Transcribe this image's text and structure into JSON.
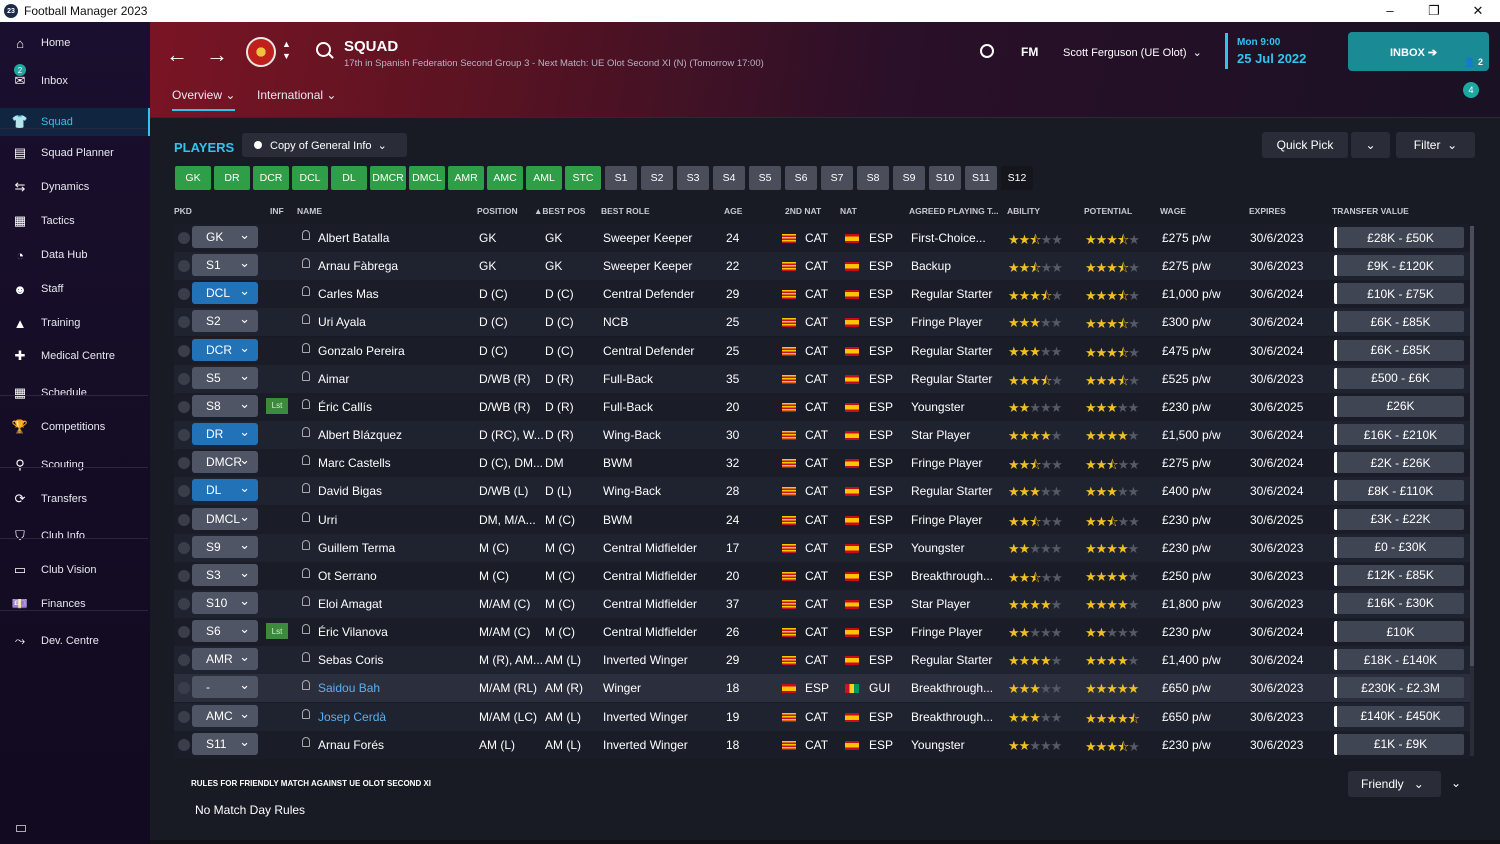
{
  "window": {
    "title": "Football Manager 2023",
    "app_icon": "23",
    "controls": [
      "–",
      "❐",
      "✕"
    ]
  },
  "sidebar": {
    "items": [
      {
        "label": "Home",
        "icon": "home-icon",
        "glyph": "⌂"
      },
      {
        "label": "Inbox",
        "icon": "inbox-icon",
        "glyph": "✉",
        "badge": "2"
      },
      {
        "label": "Squad",
        "icon": "shirt-icon",
        "glyph": "👕"
      },
      {
        "label": "Squad Planner",
        "icon": "clipboard-icon",
        "glyph": "▤"
      },
      {
        "label": "Dynamics",
        "icon": "dynamics-icon",
        "glyph": "⇆"
      },
      {
        "label": "Tactics",
        "icon": "tactics-icon",
        "glyph": "▦"
      },
      {
        "label": "Data Hub",
        "icon": "data-hub-icon",
        "glyph": "◔"
      },
      {
        "label": "Staff",
        "icon": "staff-icon",
        "glyph": "☻"
      },
      {
        "label": "Training",
        "icon": "training-icon",
        "glyph": "▲"
      },
      {
        "label": "Medical Centre",
        "icon": "medical-icon",
        "glyph": "✚"
      },
      {
        "label": "Schedule",
        "icon": "calendar-icon",
        "glyph": "▦"
      },
      {
        "label": "Competitions",
        "icon": "trophy-icon",
        "glyph": "🏆"
      },
      {
        "label": "Scouting",
        "icon": "scouting-icon",
        "glyph": "⚲"
      },
      {
        "label": "Transfers",
        "icon": "transfers-icon",
        "glyph": "⟳"
      },
      {
        "label": "Club Info",
        "icon": "shield-icon",
        "glyph": "⛉"
      },
      {
        "label": "Club Vision",
        "icon": "vision-icon",
        "glyph": "▭"
      },
      {
        "label": "Finances",
        "icon": "finances-icon",
        "glyph": "💷"
      },
      {
        "label": "Dev. Centre",
        "icon": "dev-centre-icon",
        "glyph": "⤳"
      }
    ]
  },
  "header": {
    "title": "SQUAD",
    "subtitle": "17th in Spanish Federation Second Group 3 - Next Match: UE Olot Second XI (N) (Tomorrow 17:00)",
    "tabs": [
      {
        "label": "Overview"
      },
      {
        "label": "International"
      }
    ],
    "fm_logo": "FM",
    "manager": "Scott Ferguson (UE Olot)",
    "time": "Mon 9:00",
    "date": "25 Jul 2022",
    "inbox_label": "INBOX",
    "inbox_count": "2",
    "notifications": "4"
  },
  "toolbar": {
    "players_label": "PLAYERS",
    "view_label": "Copy of General Info",
    "quick_pick": "Quick Pick",
    "filter": "Filter"
  },
  "position_filters": [
    "GK",
    "DR",
    "DCR",
    "DCL",
    "DL",
    "DMCR",
    "DMCL",
    "AMR",
    "AMC",
    "AML",
    "STC",
    "S1",
    "S2",
    "S3",
    "S4",
    "S5",
    "S6",
    "S7",
    "S8",
    "S9",
    "S10",
    "S11",
    "S12"
  ],
  "columns": {
    "pkd": "PKD",
    "inf": "INF",
    "name": "NAME",
    "position": "POSITION",
    "best_pos": "BEST POS",
    "best_role": "BEST ROLE",
    "age": "AGE",
    "nat2": "2ND NAT",
    "nat": "NAT",
    "agreed": "AGREED PLAYING T...",
    "ability": "ABILITY",
    "potential": "POTENTIAL",
    "wage": "WAGE",
    "expires": "EXPIRES",
    "value": "TRANSFER VALUE"
  },
  "players": [
    {
      "slot": "GK",
      "name": "Albert Batalla",
      "position": "GK",
      "best_pos": "GK",
      "role": "Sweeper Keeper",
      "age": "24",
      "nat2": "CAT",
      "nat": "ESP",
      "agreed": "First-Choice...",
      "ability": 2.5,
      "potential": 3.5,
      "wage": "£275 p/w",
      "expires": "30/6/2023",
      "value": "£28K - £50K"
    },
    {
      "slot": "S1",
      "name": "Arnau Fàbrega",
      "position": "GK",
      "best_pos": "GK",
      "role": "Sweeper Keeper",
      "age": "22",
      "nat2": "CAT",
      "nat": "ESP",
      "agreed": "Backup",
      "ability": 2.5,
      "potential": 3.5,
      "wage": "£275 p/w",
      "expires": "30/6/2023",
      "value": "£9K - £120K"
    },
    {
      "slot": "DCL",
      "slot_blue": true,
      "name": "Carles Mas",
      "position": "D (C)",
      "best_pos": "D (C)",
      "role": "Central Defender",
      "age": "29",
      "nat2": "CAT",
      "nat": "ESP",
      "agreed": "Regular Starter",
      "ability": 3.5,
      "potential": 3.5,
      "wage": "£1,000 p/w",
      "expires": "30/6/2024",
      "value": "£10K - £75K"
    },
    {
      "slot": "S2",
      "name": "Uri Ayala",
      "position": "D (C)",
      "best_pos": "D (C)",
      "role": "NCB",
      "age": "25",
      "nat2": "CAT",
      "nat": "ESP",
      "agreed": "Fringe Player",
      "ability": 3,
      "potential": 3.5,
      "wage": "£300 p/w",
      "expires": "30/6/2024",
      "value": "£6K - £85K"
    },
    {
      "slot": "DCR",
      "slot_blue": true,
      "name": "Gonzalo Pereira",
      "position": "D (C)",
      "best_pos": "D (C)",
      "role": "Central Defender",
      "age": "25",
      "nat2": "CAT",
      "nat": "ESP",
      "agreed": "Regular Starter",
      "ability": 3,
      "potential": 3.5,
      "wage": "£475 p/w",
      "expires": "30/6/2024",
      "value": "£6K - £85K"
    },
    {
      "slot": "S5",
      "name": "Aimar",
      "position": "D/WB (R)",
      "best_pos": "D (R)",
      "role": "Full-Back",
      "age": "35",
      "nat2": "CAT",
      "nat": "ESP",
      "agreed": "Regular Starter",
      "ability": 3.5,
      "potential": 3.5,
      "wage": "£525 p/w",
      "expires": "30/6/2023",
      "value": "£500 - £6K"
    },
    {
      "slot": "S8",
      "inf": "Lst",
      "name": "Éric Callís",
      "position": "D/WB (R)",
      "best_pos": "D (R)",
      "role": "Full-Back",
      "age": "20",
      "nat2": "CAT",
      "nat": "ESP",
      "agreed": "Youngster",
      "ability": 2,
      "potential": 3,
      "pot_white": true,
      "wage": "£230 p/w",
      "expires": "30/6/2025",
      "value": "£26K"
    },
    {
      "slot": "DR",
      "slot_blue": true,
      "name": "Albert Blázquez",
      "position": "D (RC), W...",
      "best_pos": "D (R)",
      "role": "Wing-Back",
      "age": "30",
      "nat2": "CAT",
      "nat": "ESP",
      "agreed": "Star Player",
      "ability": 4,
      "potential": 4,
      "wage": "£1,500 p/w",
      "expires": "30/6/2024",
      "value": "£16K - £210K"
    },
    {
      "slot": "DMCR",
      "name": "Marc Castells",
      "position": "D (C), DM...",
      "best_pos": "DM",
      "role": "BWM",
      "age": "32",
      "nat2": "CAT",
      "nat": "ESP",
      "agreed": "Fringe Player",
      "ability": 2.5,
      "potential": 2.5,
      "wage": "£275 p/w",
      "expires": "30/6/2024",
      "value": "£2K - £26K"
    },
    {
      "slot": "DL",
      "slot_blue": true,
      "name": "David Bigas",
      "position": "D/WB (L)",
      "best_pos": "D (L)",
      "role": "Wing-Back",
      "age": "28",
      "nat2": "CAT",
      "nat": "ESP",
      "agreed": "Regular Starter",
      "ability": 3,
      "potential": 3,
      "wage": "£400 p/w",
      "expires": "30/6/2024",
      "value": "£8K - £110K"
    },
    {
      "slot": "DMCL",
      "name": "Urri",
      "position": "DM, M/A...",
      "best_pos": "M (C)",
      "role": "BWM",
      "age": "24",
      "nat2": "CAT",
      "nat": "ESP",
      "agreed": "Fringe Player",
      "ability": 2.5,
      "potential": 2.5,
      "wage": "£230 p/w",
      "expires": "30/6/2025",
      "value": "£3K - £22K"
    },
    {
      "slot": "S9",
      "name": "Guillem Terma",
      "position": "M (C)",
      "best_pos": "M (C)",
      "role": "Central Midfielder",
      "age": "17",
      "nat2": "CAT",
      "nat": "ESP",
      "agreed": "Youngster",
      "ability": 2,
      "potential": 4,
      "pot_white": true,
      "wage": "£230 p/w",
      "expires": "30/6/2023",
      "value": "£0 - £30K"
    },
    {
      "slot": "S3",
      "name": "Ot Serrano",
      "position": "M (C)",
      "best_pos": "M (C)",
      "role": "Central Midfielder",
      "age": "20",
      "nat2": "CAT",
      "nat": "ESP",
      "agreed": "Breakthrough...",
      "ability": 2.5,
      "potential": 4,
      "pot_white": true,
      "wage": "£250 p/w",
      "expires": "30/6/2023",
      "value": "£12K - £85K"
    },
    {
      "slot": "S10",
      "name": "Eloi Amagat",
      "position": "M/AM (C)",
      "best_pos": "M (C)",
      "role": "Central Midfielder",
      "age": "37",
      "nat2": "CAT",
      "nat": "ESP",
      "agreed": "Star Player",
      "ability": 4,
      "potential": 4,
      "wage": "£1,800 p/w",
      "expires": "30/6/2023",
      "value": "£16K - £30K"
    },
    {
      "slot": "S6",
      "inf": "Lst",
      "name": "Éric Vilanova",
      "position": "M/AM (C)",
      "best_pos": "M (C)",
      "role": "Central Midfielder",
      "age": "26",
      "nat2": "CAT",
      "nat": "ESP",
      "agreed": "Fringe Player",
      "ability": 2,
      "potential": 2,
      "wage": "£230 p/w",
      "expires": "30/6/2024",
      "value": "£10K"
    },
    {
      "slot": "AMR",
      "name": "Sebas Coris",
      "position": "M (R), AM...",
      "best_pos": "AM (L)",
      "role": "Inverted Winger",
      "age": "29",
      "nat2": "CAT",
      "nat": "ESP",
      "agreed": "Regular Starter",
      "ability": 4,
      "potential": 4,
      "wage": "£1,400 p/w",
      "expires": "30/6/2024",
      "value": "£18K - £140K"
    },
    {
      "slot": "-",
      "name": "Saidou Bah",
      "name_blue": true,
      "selected": true,
      "position": "M/AM (RL)",
      "best_pos": "AM (R)",
      "role": "Winger",
      "age": "18",
      "nat2": "ESP",
      "nat": "GUI",
      "agreed": "Breakthrough...",
      "ability": 3,
      "potential": 5,
      "pot_white": true,
      "wage": "£650 p/w",
      "expires": "30/6/2023",
      "value": "£230K - £2.3M"
    },
    {
      "slot": "AMC",
      "name": "Josep Cerdà",
      "name_blue": true,
      "position": "M/AM (LC)",
      "best_pos": "AM (L)",
      "role": "Inverted Winger",
      "age": "19",
      "nat2": "CAT",
      "nat": "ESP",
      "agreed": "Breakthrough...",
      "ability": 3,
      "potential": 4.5,
      "wage": "£650 p/w",
      "expires": "30/6/2023",
      "value": "£140K - £450K"
    },
    {
      "slot": "S11",
      "name": "Arnau Forés",
      "position": "AM (L)",
      "best_pos": "AM (L)",
      "role": "Inverted Winger",
      "age": "18",
      "nat2": "CAT",
      "nat": "ESP",
      "agreed": "Youngster",
      "ability": 2,
      "potential": 3.5,
      "wage": "£230 p/w",
      "expires": "30/6/2023",
      "value": "£1K - £9K"
    }
  ],
  "rules": {
    "title": "RULES FOR FRIENDLY MATCH AGAINST UE OLOT SECOND XI",
    "text": "No Match Day Rules",
    "dropdown": "Friendly"
  }
}
